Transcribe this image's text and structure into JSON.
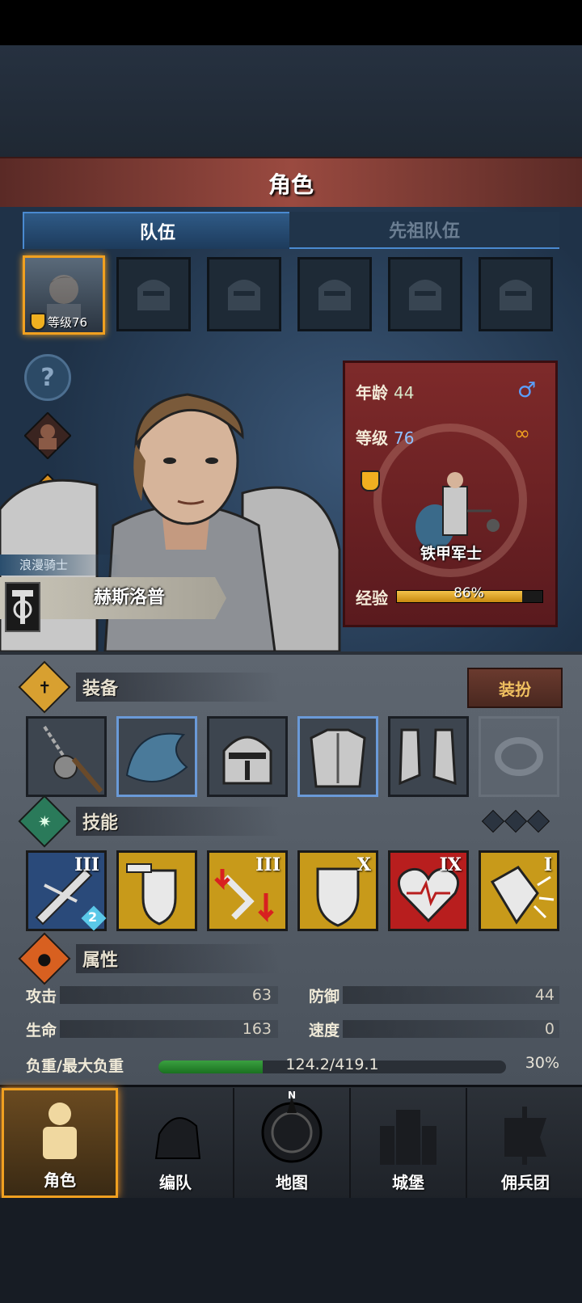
{
  "header": {
    "title": "角色"
  },
  "tabs": {
    "team": "队伍",
    "ancestor": "先祖队伍"
  },
  "hero_slot": {
    "level_text": "等级76"
  },
  "character": {
    "class_label": "浪漫骑士",
    "name": "赫斯洛普"
  },
  "info_card": {
    "age_label": "年龄",
    "age_value": "44",
    "level_label": "等级",
    "level_value": "76",
    "unit_name": "铁甲军士",
    "exp_label": "经验",
    "exp_text": "86%",
    "exp_fraction": 0.86,
    "gender_icon": "male-icon",
    "ring_icon": "ring-icon"
  },
  "equipment": {
    "title": "装备",
    "dress_button": "装扮",
    "items": [
      "flail-icon",
      "helmet-plume-icon",
      "great-helm-icon",
      "chest-armor-icon",
      "boots-icon",
      "ring-empty-icon"
    ]
  },
  "skills": {
    "title": "技能",
    "items": [
      {
        "icon": "sword-strike-icon",
        "rank": "III",
        "badge": "2",
        "color": "#2a4a7a"
      },
      {
        "icon": "shield-bash-icon",
        "rank": "",
        "color": "#c89a1a"
      },
      {
        "icon": "armor-break-icon",
        "rank": "III",
        "color": "#c89a1a"
      },
      {
        "icon": "shield-icon",
        "rank": "X",
        "color": "#c89a1a"
      },
      {
        "icon": "heart-icon",
        "rank": "IX",
        "color": "#b81e1e"
      },
      {
        "icon": "shatter-icon",
        "rank": "I",
        "color": "#c89a1a"
      }
    ]
  },
  "attributes": {
    "title": "属性",
    "attack_label": "攻击",
    "attack_value": "63",
    "defense_label": "防御",
    "defense_value": "44",
    "hp_label": "生命",
    "hp_value": "163",
    "speed_label": "速度",
    "speed_value": "0",
    "load_label": "负重/最大负重",
    "load_text": "124.2/419.1",
    "load_percent": "30%",
    "load_fraction": 0.3
  },
  "nav": {
    "character": "角色",
    "formation": "编队",
    "map": "地图",
    "castle": "城堡",
    "mercenary": "佣兵团",
    "compass_n": "N"
  }
}
